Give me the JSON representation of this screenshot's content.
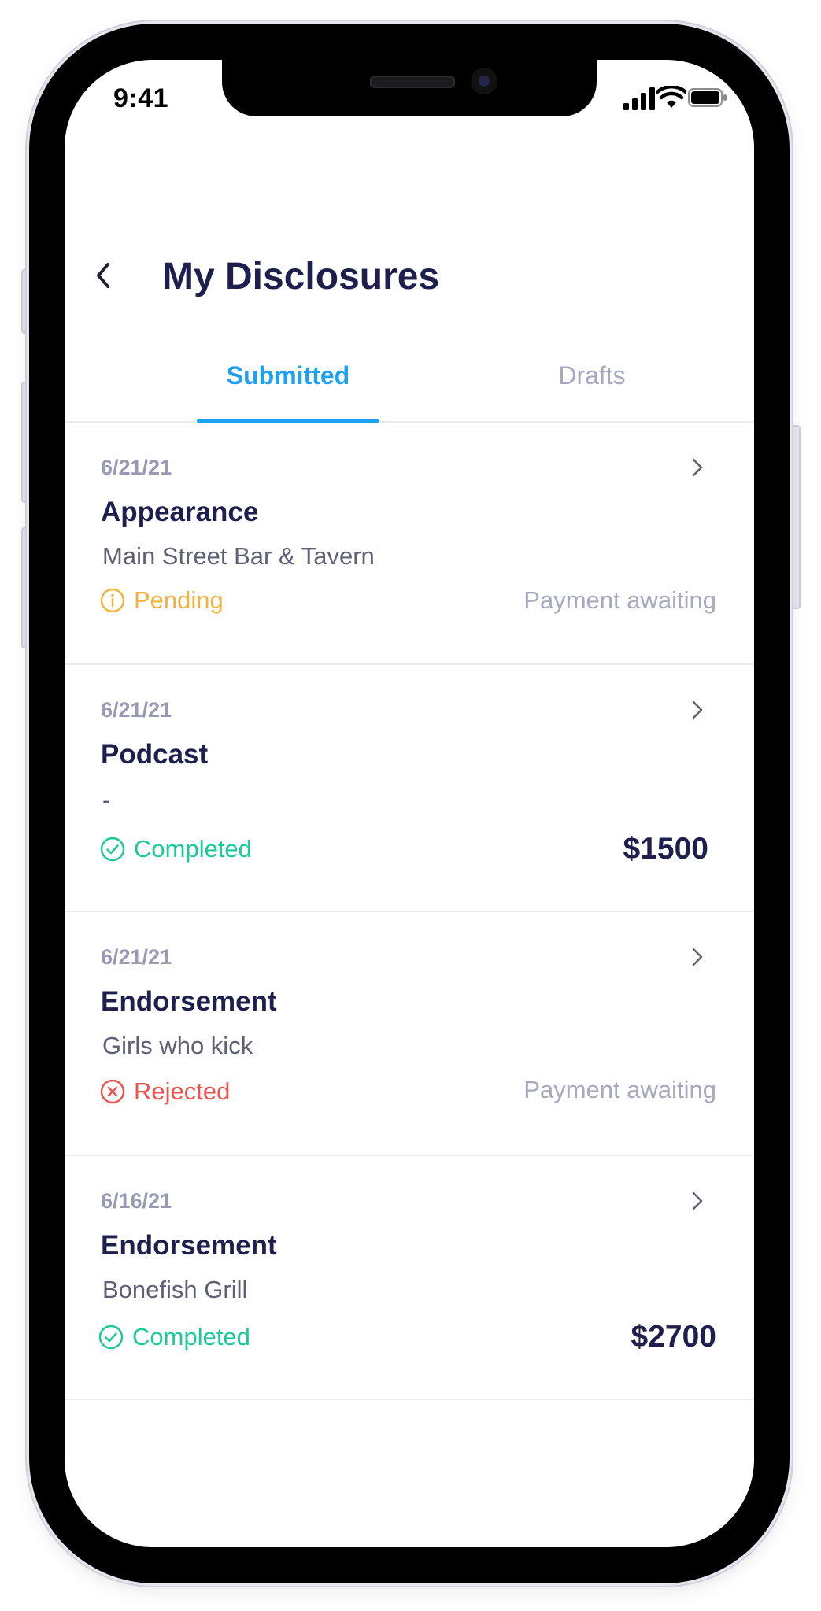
{
  "status_bar": {
    "time": "9:41"
  },
  "header": {
    "title": "My Disclosures"
  },
  "tabs": [
    {
      "label": "Submitted",
      "active": true
    },
    {
      "label": "Drafts",
      "active": false
    }
  ],
  "disclosures": [
    {
      "date": "6/21/21",
      "type": "Appearance",
      "venue": "Main Street Bar & Tavern",
      "status": "Pending",
      "right": "Payment awaiting"
    },
    {
      "date": "6/21/21",
      "type": "Podcast",
      "venue": "-",
      "status": "Completed",
      "right": "$1500"
    },
    {
      "date": "6/21/21",
      "type": "Endorsement",
      "venue": "Girls who kick",
      "status": "Rejected",
      "right": "Payment awaiting"
    },
    {
      "date": "6/16/21",
      "type": "Endorsement",
      "venue": "Bonefish Grill",
      "status": "Completed",
      "right": "$2700"
    }
  ],
  "colors": {
    "accent": "#1da1f2",
    "title": "#1f1f4d",
    "pending": "#f2b33d",
    "completed": "#1cc99a",
    "rejected": "#f0524e"
  },
  "icons": [
    "back-chevron-icon",
    "chevron-right-icon",
    "info-circle-icon",
    "check-circle-icon",
    "x-circle-icon",
    "signal-icon",
    "wifi-icon",
    "battery-icon"
  ]
}
